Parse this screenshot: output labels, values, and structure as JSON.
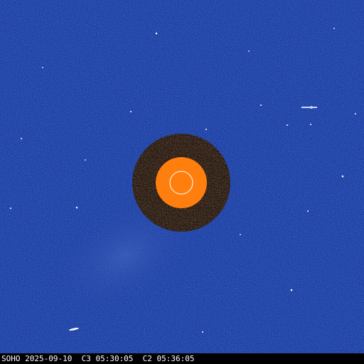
{
  "caption": "SOHO 2025-09-10  C3 05:30:05  C2 05:36:05",
  "colors": {
    "background": "#1b3fa3",
    "occulter_c2_ring": "#2a1a10",
    "occulter_c3_disk": "#ff7f0e",
    "sun_circle": "#ffffff",
    "stars": "#ffffff"
  }
}
